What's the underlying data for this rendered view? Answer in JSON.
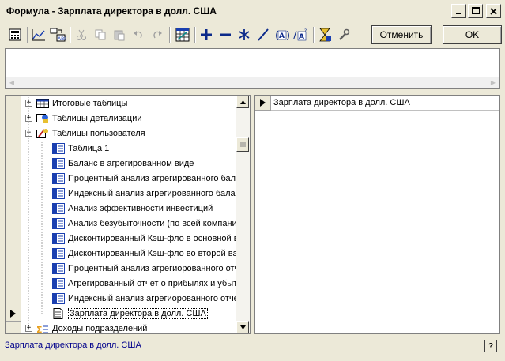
{
  "window": {
    "title": "Формула - Зарплата директора в долл. США"
  },
  "toolbar": {
    "cancel_label": "Отменить",
    "ok_label": "OK",
    "icons": [
      "calculator-icon",
      "chart-icon",
      "code-icon",
      "cut-icon",
      "copy-icon",
      "paste-icon",
      "undo-icon",
      "redo-icon",
      "grid-icon",
      "plus-icon",
      "minus-icon",
      "multiply-icon",
      "divide-icon",
      "function-a-icon",
      "function-a-slash-icon",
      "sort-icon",
      "wrench-icon"
    ]
  },
  "tree": {
    "items": [
      {
        "label": "Итоговые таблицы",
        "icon": "table-icon",
        "expander": "+"
      },
      {
        "label": "Таблицы детализации",
        "icon": "detail-icon",
        "expander": "+"
      },
      {
        "label": "Таблицы пользователя",
        "icon": "user-tables-icon",
        "expander": "−"
      },
      {
        "label": "Таблица 1",
        "icon": "report-icon"
      },
      {
        "label": "Баланс в агрегированном виде",
        "icon": "report-icon"
      },
      {
        "label": "Процентный анализ агрегированного бала",
        "icon": "report-icon"
      },
      {
        "label": "Индексный анализ агрегированного бала",
        "icon": "report-icon"
      },
      {
        "label": "Анализ эффективности инвестиций",
        "icon": "report-icon"
      },
      {
        "label": "Анализ безубыточности (по всей компани",
        "icon": "report-icon"
      },
      {
        "label": "Дисконтированный Кэш-фло в основной в",
        "icon": "report-icon"
      },
      {
        "label": "Дисконтированный Кэш-фло во второй ва",
        "icon": "report-icon"
      },
      {
        "label": "Процентный анализ агрегиорованного отч",
        "icon": "report-icon"
      },
      {
        "label": "Агрегированный отчет о прибылях и убытк",
        "icon": "report-icon"
      },
      {
        "label": "Индексный анализ агрегиорованного отче",
        "icon": "report-icon"
      },
      {
        "label": "Зарплата директора в долл. США",
        "icon": "document-icon"
      },
      {
        "label": "Доходы подразделений",
        "icon": "division-icon",
        "expander": "+"
      }
    ]
  },
  "right_pane": {
    "items": [
      {
        "label": "Зарплата директора в долл. США"
      }
    ]
  },
  "status": {
    "text": "Зарплата директора в долл. США"
  }
}
